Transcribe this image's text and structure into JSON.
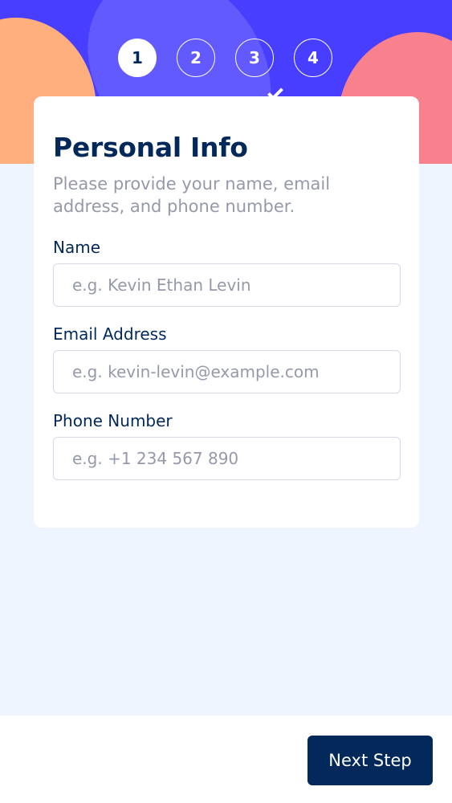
{
  "stepper": {
    "steps": [
      "1",
      "2",
      "3",
      "4"
    ],
    "active_index": 0
  },
  "form": {
    "title": "Personal Info",
    "subtitle": "Please provide your name, email address, and phone number.",
    "fields": {
      "name": {
        "label": "Name",
        "placeholder": "e.g. Kevin Ethan Levin"
      },
      "email": {
        "label": "Email Address",
        "placeholder": "e.g. kevin-levin@example.com"
      },
      "phone": {
        "label": "Phone Number",
        "placeholder": "e.g. +1 234 567 890"
      }
    }
  },
  "footer": {
    "next_label": "Next Step"
  },
  "colors": {
    "primary": "#02295a",
    "accent": "#483eff",
    "background": "#eff5ff",
    "muted_text": "#9699ab",
    "border": "#d6d9e6",
    "deco_orange": "#ffaf7e",
    "deco_pink": "#f9818e"
  }
}
